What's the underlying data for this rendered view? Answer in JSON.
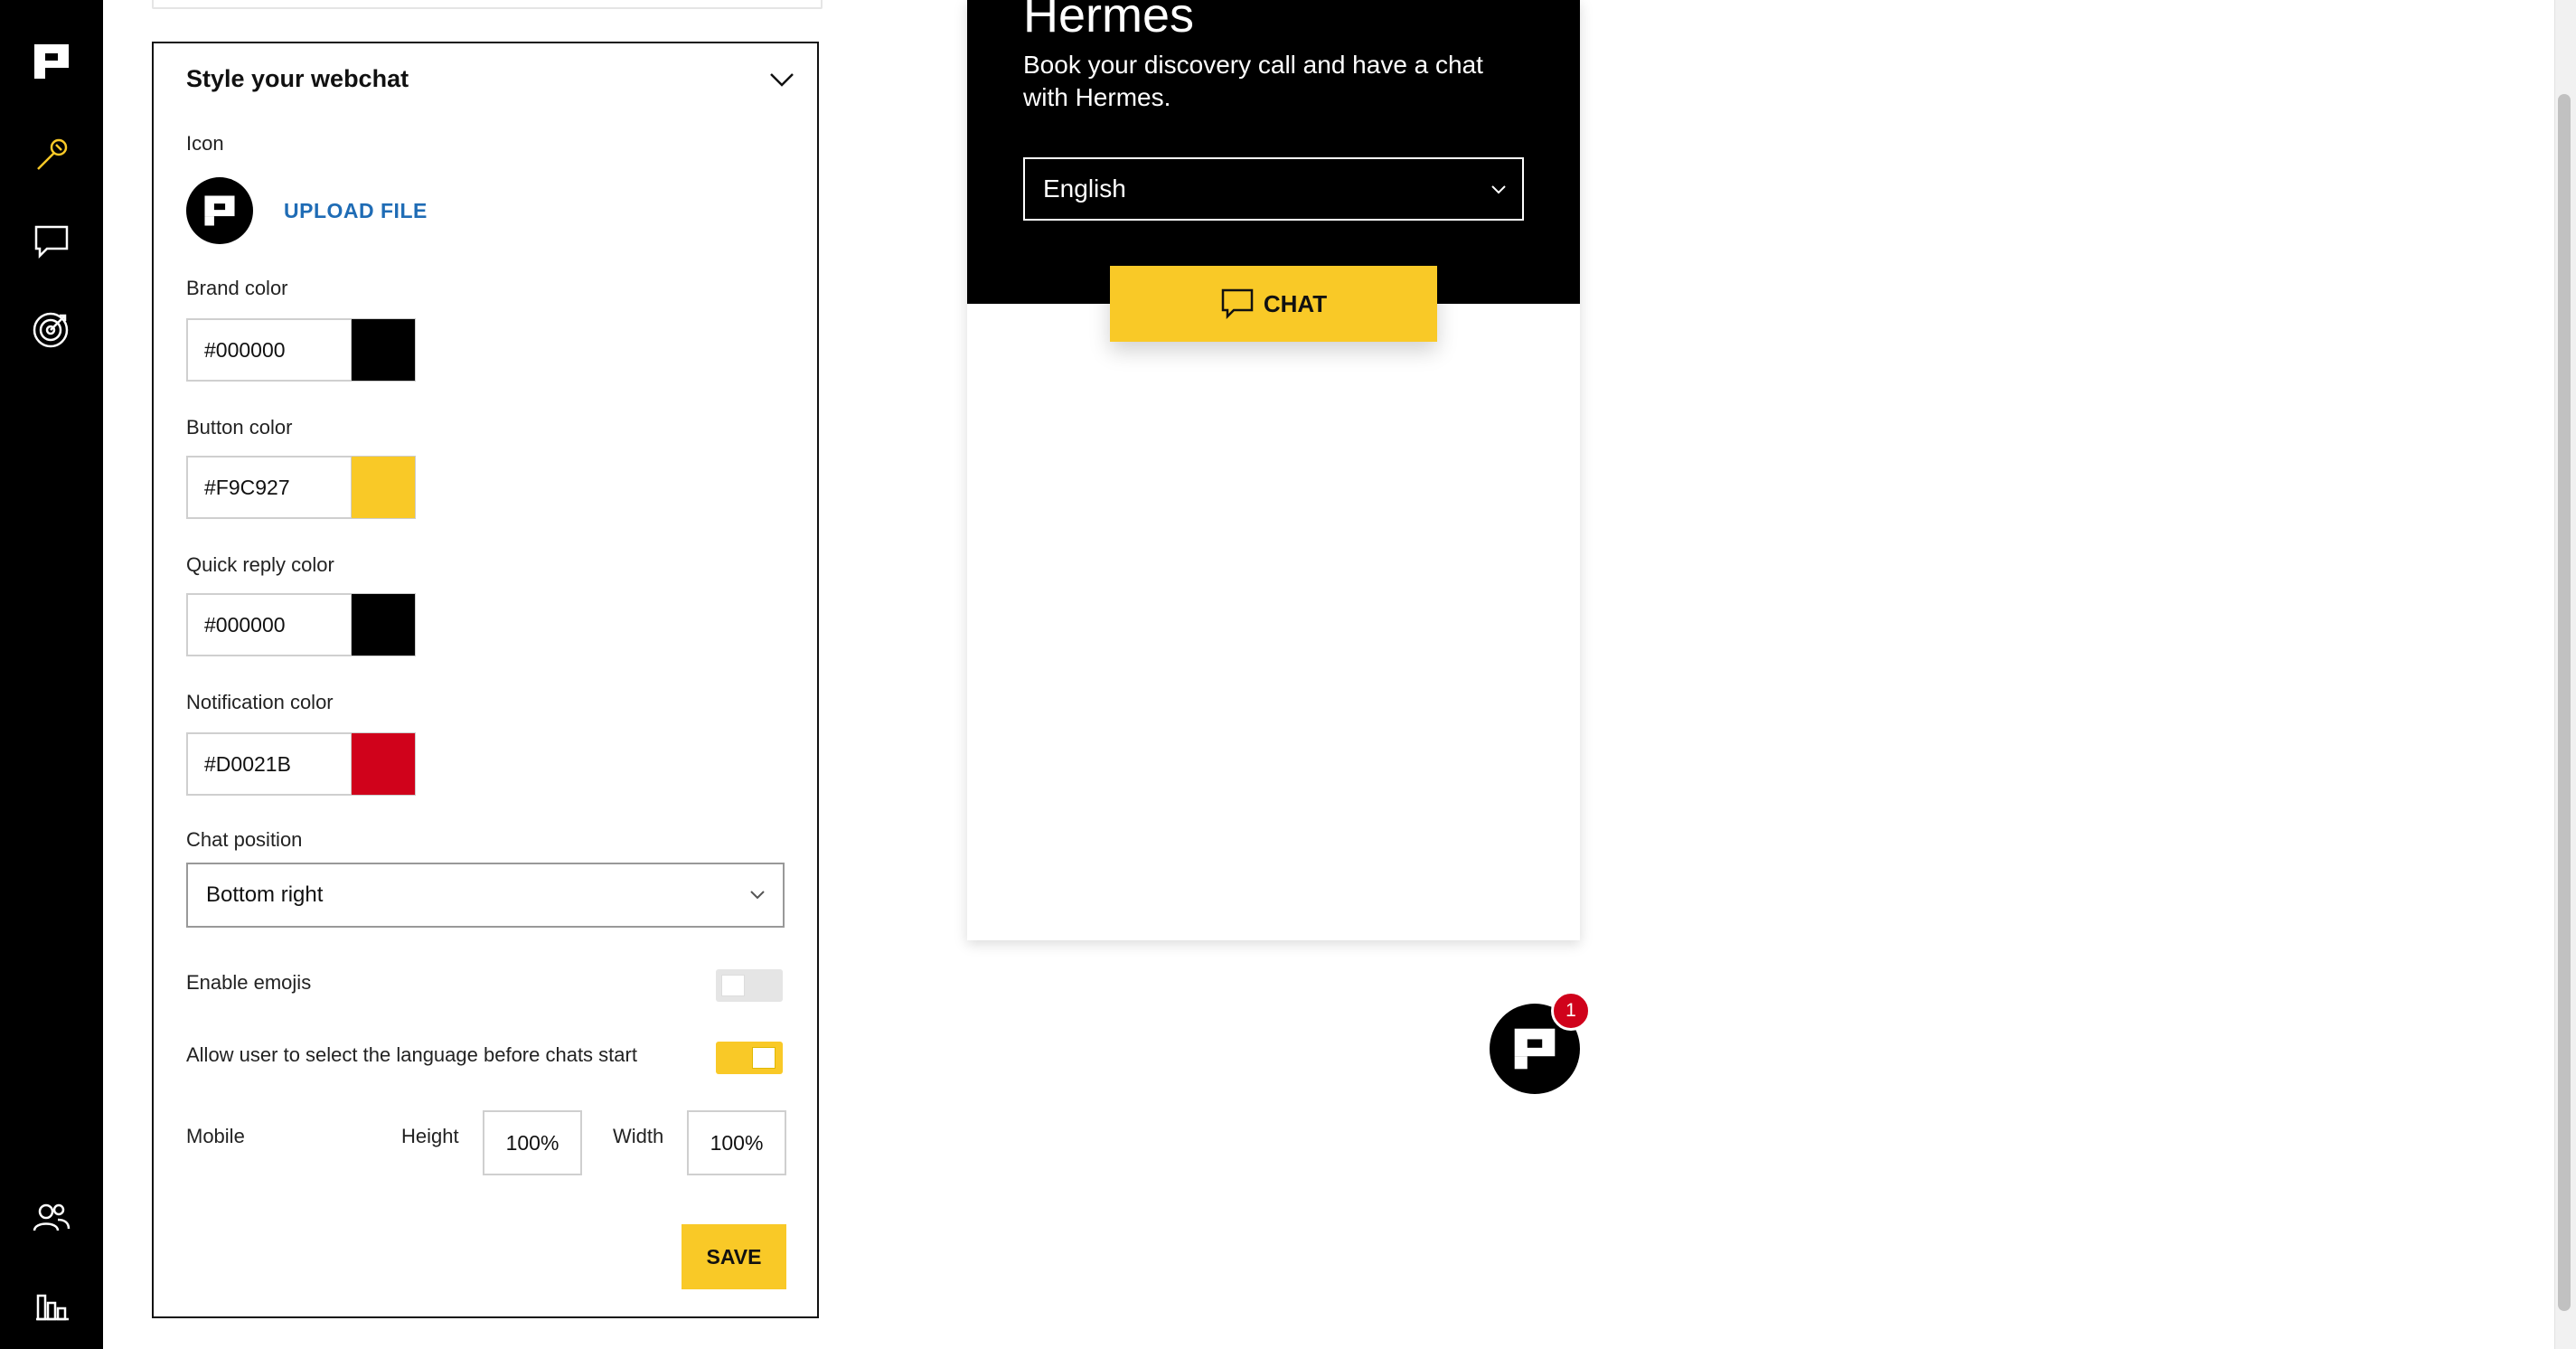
{
  "colors": {
    "brand": "#000000",
    "button": "#F9C927",
    "quick_reply": "#000000",
    "notification": "#D0021B",
    "link": "#1f6cb5"
  },
  "rail": {
    "items": [
      {
        "icon": "logo-icon"
      },
      {
        "icon": "wrench-icon",
        "active": true
      },
      {
        "icon": "chat-icon"
      },
      {
        "icon": "target-icon"
      },
      {
        "icon": "users-icon"
      },
      {
        "icon": "bar-chart-icon"
      }
    ]
  },
  "panel": {
    "title": "Style your webchat",
    "icon_label": "Icon",
    "upload_label": "UPLOAD FILE",
    "brand_color": {
      "label": "Brand color",
      "value": "#000000"
    },
    "button_color": {
      "label": "Button color",
      "value": "#F9C927"
    },
    "quick_reply_color": {
      "label": "Quick reply color",
      "value": "#000000"
    },
    "notification_color": {
      "label": "Notification color",
      "value": "#D0021B"
    },
    "chat_position": {
      "label": "Chat position",
      "value": "Bottom right"
    },
    "enable_emojis": {
      "label": "Enable emojis",
      "on": false
    },
    "language_select": {
      "label": "Allow user to select the language before chats start",
      "on": true
    },
    "mobile": {
      "label": "Mobile",
      "height_label": "Height",
      "height_value": "100%",
      "width_label": "Width",
      "width_value": "100%"
    },
    "save_label": "SAVE"
  },
  "preview": {
    "title": "Hermes",
    "subtitle": "Book your discovery call and have a chat with Hermes.",
    "language": "English",
    "chat_label": "CHAT",
    "badge_count": "1"
  }
}
